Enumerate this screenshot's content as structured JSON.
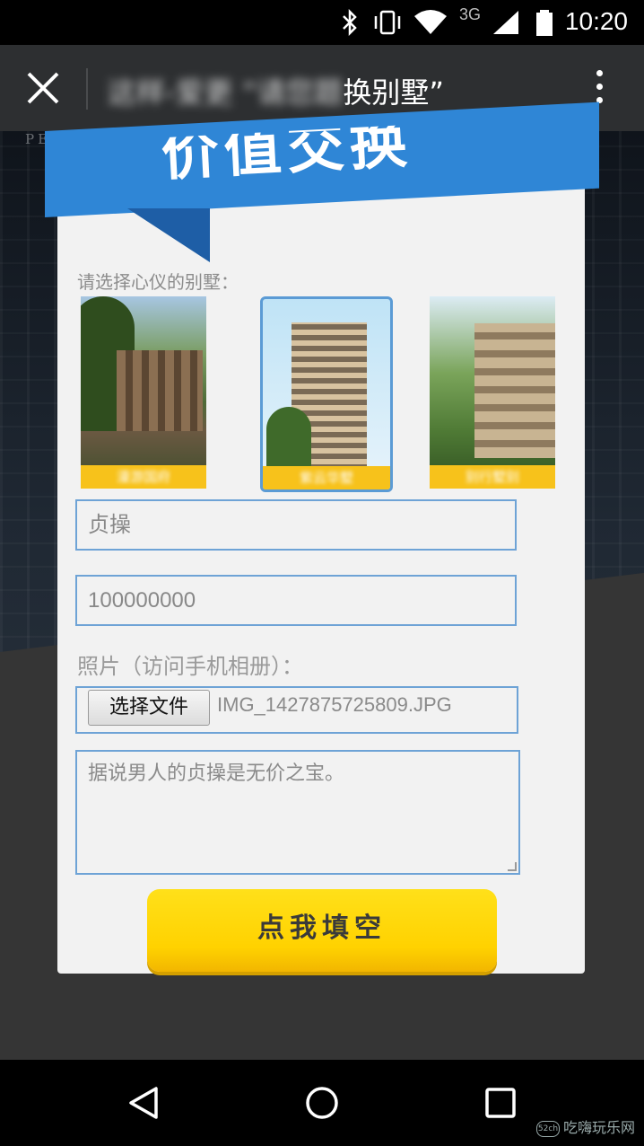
{
  "status_bar": {
    "time": "10:20",
    "network": "3G",
    "icons": [
      "bluetooth-icon",
      "vibrate-icon",
      "wifi-icon",
      "cell-signal-icon",
      "battery-icon"
    ]
  },
  "title_bar": {
    "title_blurred": "这样-爱更 “请您题",
    "title_visible": "换别墅”"
  },
  "background": {
    "brand_text": "PERFECT"
  },
  "banner": {
    "heading": "价值交换"
  },
  "form": {
    "prompt": "请选择心仪的别墅：",
    "villas": [
      {
        "caption": "漫游国府",
        "selected": false
      },
      {
        "caption": "紫云华墅",
        "selected": true
      },
      {
        "caption": "别行墅别",
        "selected": false
      }
    ],
    "name_field_value": "贞操",
    "phone_field_value": "100000000",
    "photo_label": "照片（访问手机相册）：",
    "file_button_label": "选择文件",
    "file_name": "IMG_1427875725809.JPG",
    "message_value": "据说男人的贞操是无价之宝。",
    "submit_label": "点我填空"
  },
  "nav_bar": {
    "icons": [
      "back-icon",
      "home-icon",
      "recents-icon"
    ]
  },
  "watermark": {
    "logo": "52ch",
    "text": "吃嗨玩乐网"
  },
  "colors": {
    "accent_blue": "#2f86d6",
    "field_border": "#6ea3d6",
    "button_yellow": "#ffd200",
    "caption_yellow": "#f7c21b"
  }
}
